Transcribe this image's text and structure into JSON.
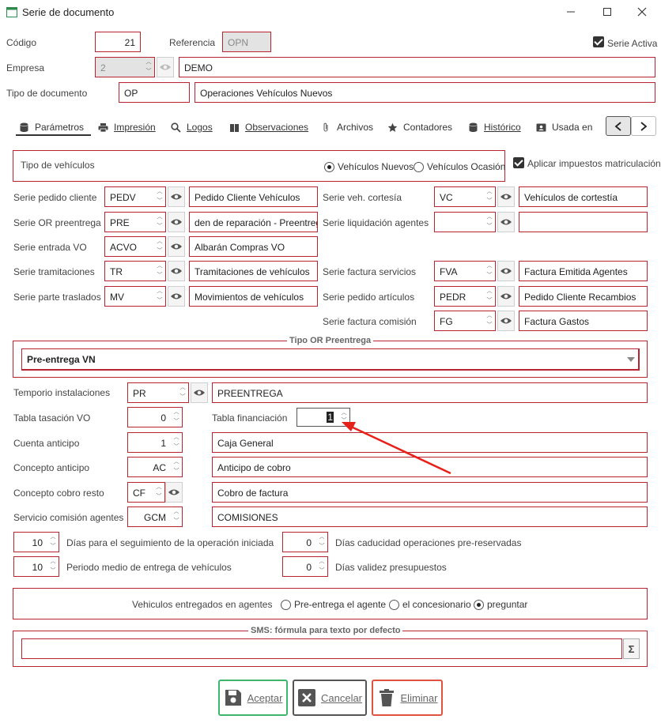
{
  "window": {
    "title": "Serie de documento"
  },
  "header": {
    "codigo_label": "Código",
    "codigo_value": "21",
    "referencia_label": "Referencia",
    "referencia_value": "OPN",
    "serie_activa_label": "Serie Activa",
    "empresa_label": "Empresa",
    "empresa_value": "2",
    "empresa_name": "DEMO",
    "tipo_doc_label": "Tipo de documento",
    "tipo_doc_code": "OP",
    "tipo_doc_name": "Operaciones Vehículos Nuevos"
  },
  "tabs": [
    {
      "label": "Parámetros",
      "icon": "database-icon"
    },
    {
      "label": "Impresión",
      "icon": "printer-icon"
    },
    {
      "label": "Logos",
      "icon": "search-icon"
    },
    {
      "label": "Observaciones",
      "icon": "book-icon"
    },
    {
      "label": "Archivos",
      "icon": "paperclip-icon"
    },
    {
      "label": "Contadores",
      "icon": "star-icon"
    },
    {
      "label": "Histórico",
      "icon": "database-icon"
    },
    {
      "label": "Usada en",
      "icon": "id-card-icon"
    }
  ],
  "tipo_vehiculos": {
    "label": "Tipo de vehículos",
    "option1": "Vehículos Nuevos",
    "option2": "Vehículos Ocasión",
    "selected": "Vehículos Nuevos"
  },
  "aplicar_impuestos_label": "Aplicar impuestos matriculación",
  "left_series": [
    {
      "label": "Serie pedido cliente",
      "code": "PEDV",
      "name": "Pedido Cliente Vehículos"
    },
    {
      "label": "Serie OR preentrega",
      "code": "PRE",
      "name": "den de reparación - Preentrega"
    },
    {
      "label": "Serie entrada VO",
      "code": "ACVO",
      "name": "Albarán Compras VO"
    },
    {
      "label": "Serie tramitaciones",
      "code": "TR",
      "name": "Tramitaciones de vehículos"
    },
    {
      "label": "Serie parte traslados",
      "code": "MV",
      "name": "Movimientos de vehículos"
    }
  ],
  "right_series": [
    {
      "label": "Serie veh. cortesía",
      "code": "VC",
      "name": "Vehículos de cortestía"
    },
    {
      "label": "Serie liquidación agentes",
      "code": "",
      "name": ""
    },
    {
      "label": "Serie factura servicios",
      "code": "FVA",
      "name": "Factura Emitida Agentes"
    },
    {
      "label": "Serie pedido artículos",
      "code": "PEDR",
      "name": "Pedido Cliente Recambios"
    },
    {
      "label": "Serie factura comisión",
      "code": "FG",
      "name": "Factura Gastos"
    }
  ],
  "tipo_or": {
    "title": "Tipo OR Preentrega",
    "value": "Pre-entrega VN"
  },
  "lower": {
    "tempario_label": "Temporio instalaciones",
    "tempario_code": "PR",
    "tempario_name": "PREENTREGA",
    "tabla_tasacion_label": "Tabla tasación VO",
    "tabla_tasacion_value": "0",
    "tabla_financiacion_label": "Tabla financiación",
    "tabla_financiacion_value": "1",
    "cuenta_anticipo_label": "Cuenta anticipo",
    "cuenta_anticipo_value": "1",
    "cuenta_anticipo_name": "Caja General",
    "concepto_anticipo_label": "Concepto anticipo",
    "concepto_anticipo_value": "AC",
    "concepto_anticipo_name": "Anticipo de cobro",
    "concepto_cobro_label": "Concepto cobro resto",
    "concepto_cobro_value": "CF",
    "concepto_cobro_name": "Cobro de factura",
    "servicio_comision_label": "Servicio comisión agentes",
    "servicio_comision_value": "GCM",
    "servicio_comision_name": "COMISIONES"
  },
  "dias": {
    "seguimiento_value": "10",
    "seguimiento_label": "Días para el seguimiento de la operación iniciada",
    "caducidad_value": "0",
    "caducidad_label": "Días caducidad operaciones pre-reservadas",
    "entrega_value": "10",
    "entrega_label": "Periodo medio de entrega de vehículos",
    "validez_value": "0",
    "validez_label": "Días validez presupuestos"
  },
  "entregados": {
    "label": "Vehiculos entregados en agentes",
    "option1": "Pre-entrega el agente",
    "option2": "el concesionario",
    "option3": "preguntar",
    "selected": "preguntar"
  },
  "sms": {
    "title": "SMS: fórmula para texto por defecto",
    "value": ""
  },
  "buttons": {
    "aceptar": "Aceptar",
    "cancelar": "Cancelar",
    "eliminar": "Eliminar"
  },
  "colors": {
    "accent_border": "#b9232f",
    "aceptar": "#3fb56b",
    "cancelar": "#555555",
    "eliminar": "#e0533f",
    "arrow": "#e8201a"
  }
}
